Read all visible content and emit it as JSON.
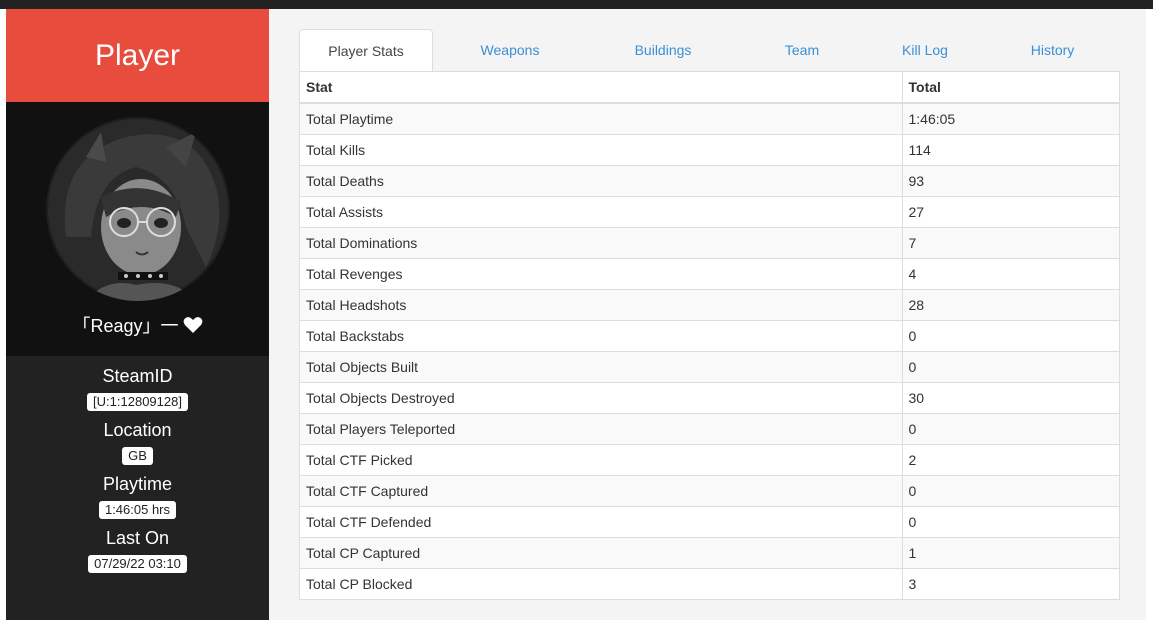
{
  "sidebar": {
    "header_title": "Player",
    "player_name": "「Reagy」一",
    "info": [
      {
        "label": "SteamID",
        "value": "[U:1:12809128]"
      },
      {
        "label": "Location",
        "value": "GB"
      },
      {
        "label": "Playtime",
        "value": "1:46:05 hrs"
      },
      {
        "label": "Last On",
        "value": "07/29/22 03:10"
      }
    ]
  },
  "tabs": [
    {
      "label": "Player Stats",
      "active": true
    },
    {
      "label": "Weapons",
      "active": false
    },
    {
      "label": "Buildings",
      "active": false
    },
    {
      "label": "Team",
      "active": false
    },
    {
      "label": "Kill Log",
      "active": false
    },
    {
      "label": "History",
      "active": false
    }
  ],
  "stats_table": {
    "headers": [
      "Stat",
      "Total"
    ],
    "rows": [
      [
        "Total Playtime",
        "1:46:05"
      ],
      [
        "Total Kills",
        "114"
      ],
      [
        "Total Deaths",
        "93"
      ],
      [
        "Total Assists",
        "27"
      ],
      [
        "Total Dominations",
        "7"
      ],
      [
        "Total Revenges",
        "4"
      ],
      [
        "Total Headshots",
        "28"
      ],
      [
        "Total Backstabs",
        "0"
      ],
      [
        "Total Objects Built",
        "0"
      ],
      [
        "Total Objects Destroyed",
        "30"
      ],
      [
        "Total Players Teleported",
        "0"
      ],
      [
        "Total CTF Picked",
        "2"
      ],
      [
        "Total CTF Captured",
        "0"
      ],
      [
        "Total CTF Defended",
        "0"
      ],
      [
        "Total CP Captured",
        "1"
      ],
      [
        "Total CP Blocked",
        "3"
      ]
    ]
  },
  "colors": {
    "header_red": "#e74c3c",
    "sidebar_dark": "#222222",
    "link_blue": "#3a8fd6"
  },
  "icons": {
    "heart": "heart-icon",
    "avatar": "anime-avatar"
  }
}
